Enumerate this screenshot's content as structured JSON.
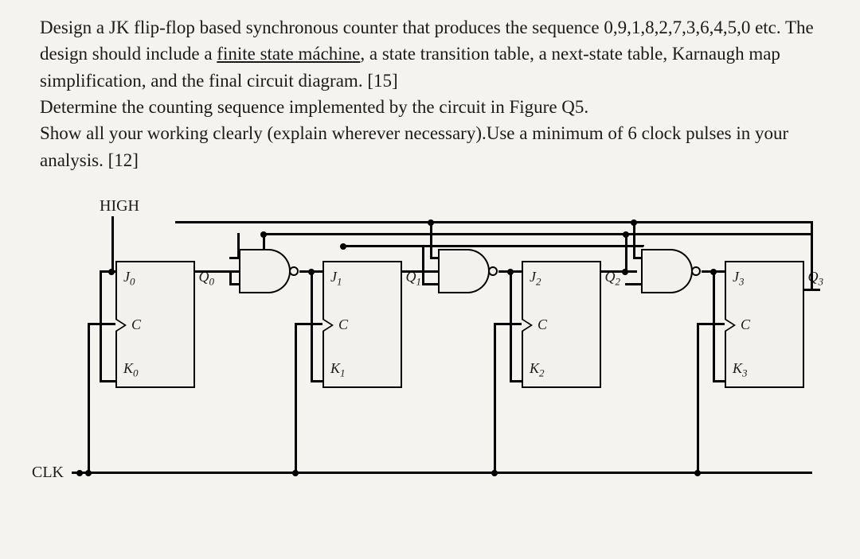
{
  "problem": {
    "part_a": "Design a JK flip-flop based synchronous counter that produces the sequence 0,9,1,8,2,7,3,6,4,5,0 etc. The design should include a ",
    "part_a_u": "finite state máchine",
    "part_a_tail": ", a state transition table, a next-state table, Karnaugh map simplification, and the final circuit diagram. [15]",
    "part_b": "Determine the counting sequence implemented by the circuit in Figure Q5.",
    "part_b2": "Show all your working clearly (explain wherever necessary).Use a minimum of 6 clock pulses in your analysis. [12]"
  },
  "diagram": {
    "high_label": "HIGH",
    "clk_label": "CLK",
    "ff": [
      {
        "j": "J",
        "jsub": "0",
        "k": "K",
        "ksub": "0",
        "c": "C",
        "q": "Q",
        "qsub": "0"
      },
      {
        "j": "J",
        "jsub": "1",
        "k": "K",
        "ksub": "1",
        "c": "C",
        "q": "Q",
        "qsub": "1"
      },
      {
        "j": "J",
        "jsub": "2",
        "k": "K",
        "ksub": "2",
        "c": "C",
        "q": "Q",
        "qsub": "2"
      },
      {
        "j": "J",
        "jsub": "3",
        "k": "K",
        "ksub": "3",
        "c": "C",
        "q": "Q",
        "qsub": "3"
      }
    ]
  }
}
